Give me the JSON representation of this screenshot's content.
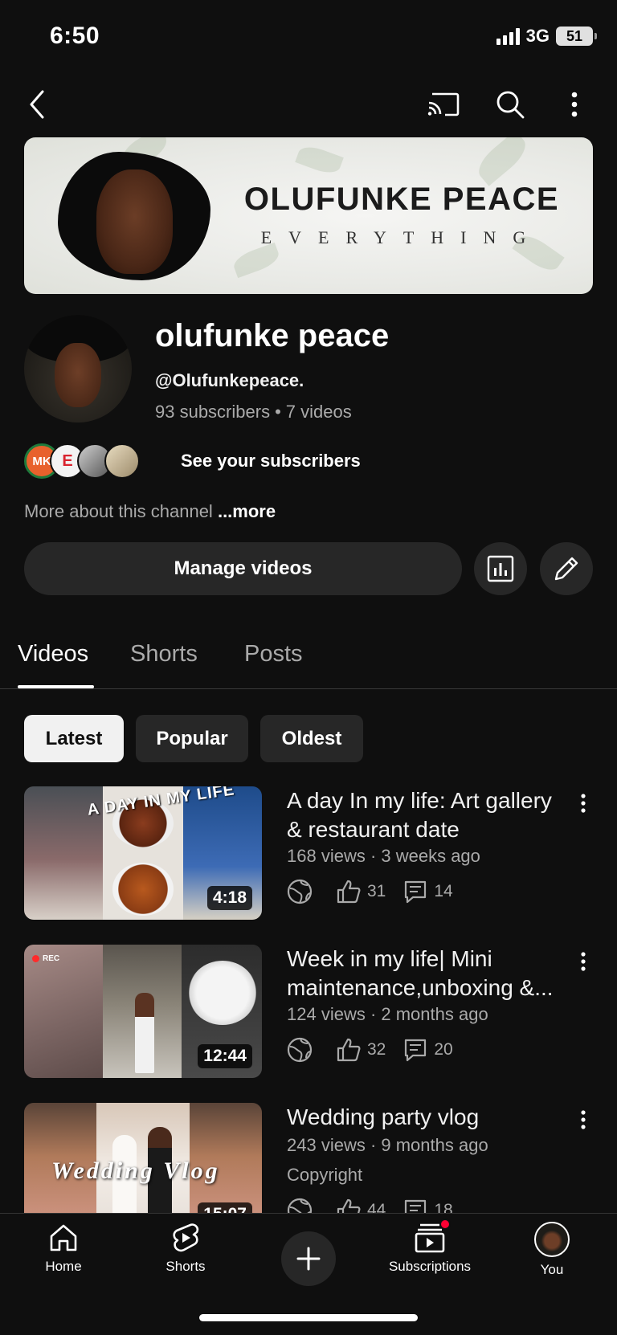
{
  "status": {
    "time": "6:50",
    "network": "3G",
    "battery": "51"
  },
  "banner": {
    "title": "OLUFUNKE PEACE",
    "subtitle": "EVERYTHING"
  },
  "channel": {
    "name": "olufunke peace",
    "handle": "@Olufunkepeace.",
    "subscribers": "93 subscribers",
    "separator": "•",
    "videos_count": "7 videos",
    "see_subscribers": "See your subscribers",
    "more_about": "More about this channel",
    "more_link": "...more",
    "subscriber_avatars": [
      {
        "label": "MK",
        "color": "#e8612c"
      },
      {
        "label": "E",
        "color": "#d9232e"
      },
      {
        "label": "",
        "color": "#8a8a8a"
      },
      {
        "label": "",
        "color": "#c9b58a"
      }
    ]
  },
  "actions": {
    "manage_videos": "Manage videos"
  },
  "tabs": [
    {
      "label": "Videos",
      "active": true
    },
    {
      "label": "Shorts",
      "active": false
    },
    {
      "label": "Posts",
      "active": false
    }
  ],
  "filters": [
    {
      "label": "Latest",
      "active": true
    },
    {
      "label": "Popular",
      "active": false
    },
    {
      "label": "Oldest",
      "active": false
    }
  ],
  "videos": [
    {
      "title": "A day In my life: Art gallery & restaurant  date",
      "meta": "168 views · 3 weeks ago",
      "duration": "4:18",
      "likes": "31",
      "comments": "14",
      "thumb_text": "A DAY IN MY LIFE"
    },
    {
      "title": "Week in my life| Mini maintenance,unboxing &...",
      "meta": "124 views · 2 months ago",
      "duration": "12:44",
      "likes": "32",
      "comments": "20",
      "thumb_text": "REC"
    },
    {
      "title": "Wedding party  vlog",
      "meta": "243 views · 9 months ago",
      "extra": "Copyright",
      "duration": "15:07",
      "likes": "44",
      "comments": "18",
      "thumb_text": "Wedding Vlog"
    }
  ],
  "bottom_nav": {
    "home": "Home",
    "shorts": "Shorts",
    "subscriptions": "Subscriptions",
    "you": "You"
  },
  "colors": {
    "background": "#0f0f0f",
    "surface": "#272727",
    "notification": "#ff0033"
  }
}
